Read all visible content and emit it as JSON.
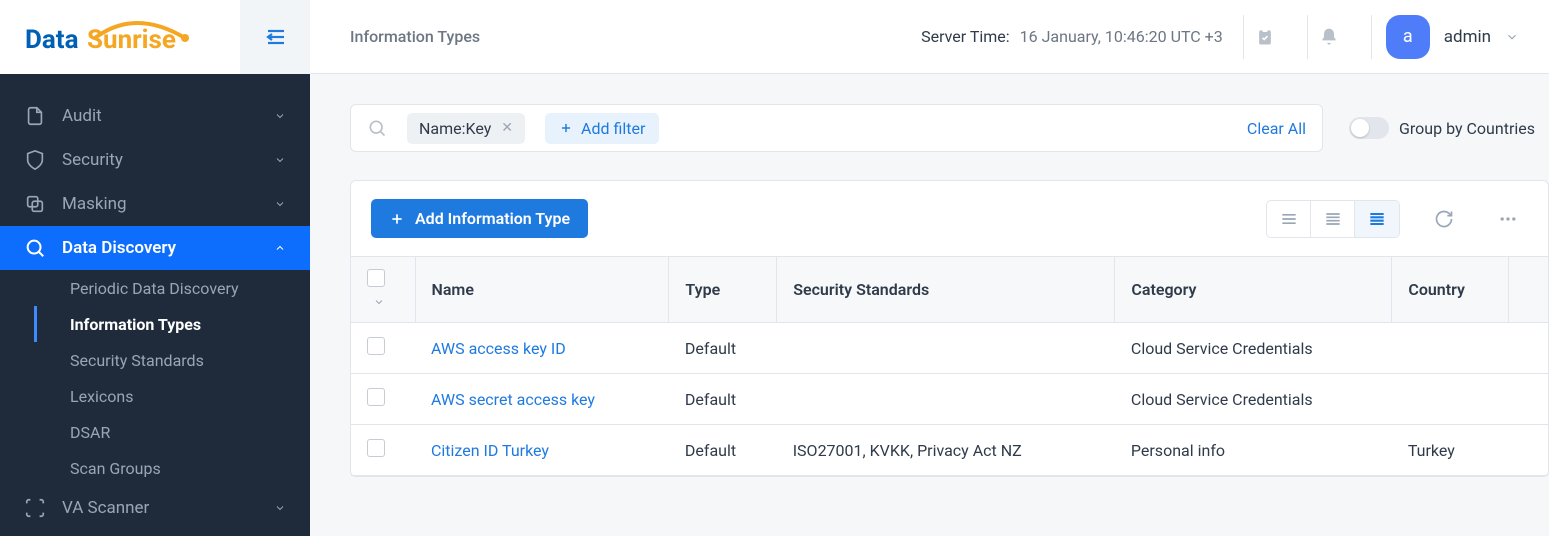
{
  "header": {
    "page_title": "Information Types",
    "server_time_label": "Server Time:",
    "server_time_value": "16 January, 10:46:20  UTC +3",
    "avatar_letter": "a",
    "username": "admin"
  },
  "sidebar": {
    "items": [
      {
        "label": "Audit",
        "icon": "file-icon"
      },
      {
        "label": "Security",
        "icon": "shield-icon"
      },
      {
        "label": "Masking",
        "icon": "copy-icon"
      },
      {
        "label": "Data Discovery",
        "icon": "search-icon",
        "active": true
      },
      {
        "label": "VA Scanner",
        "icon": "scan-icon"
      }
    ],
    "sub_items": [
      {
        "label": "Periodic Data Discovery"
      },
      {
        "label": "Information Types",
        "current": true
      },
      {
        "label": "Security Standards"
      },
      {
        "label": "Lexicons"
      },
      {
        "label": "DSAR"
      },
      {
        "label": "Scan Groups"
      }
    ]
  },
  "filter": {
    "chip": "Name:Key",
    "add_filter": "Add filter",
    "clear_all": "Clear All",
    "group_label": "Group by Countries"
  },
  "toolbar": {
    "add_button": "Add Information Type"
  },
  "table": {
    "columns": [
      "Name",
      "Type",
      "Security Standards",
      "Category",
      "Country"
    ],
    "rows": [
      {
        "name": "AWS access key ID",
        "type": "Default",
        "standards": "",
        "category": "Cloud Service Credentials",
        "country": ""
      },
      {
        "name": "AWS secret access key",
        "type": "Default",
        "standards": "",
        "category": "Cloud Service Credentials",
        "country": ""
      },
      {
        "name": "Citizen ID Turkey",
        "type": "Default",
        "standards": "ISO27001, KVKK, Privacy Act NZ",
        "category": "Personal info",
        "country": "Turkey"
      }
    ]
  },
  "logo": {
    "prefix": "Data",
    "suffix": "Sunrise"
  }
}
